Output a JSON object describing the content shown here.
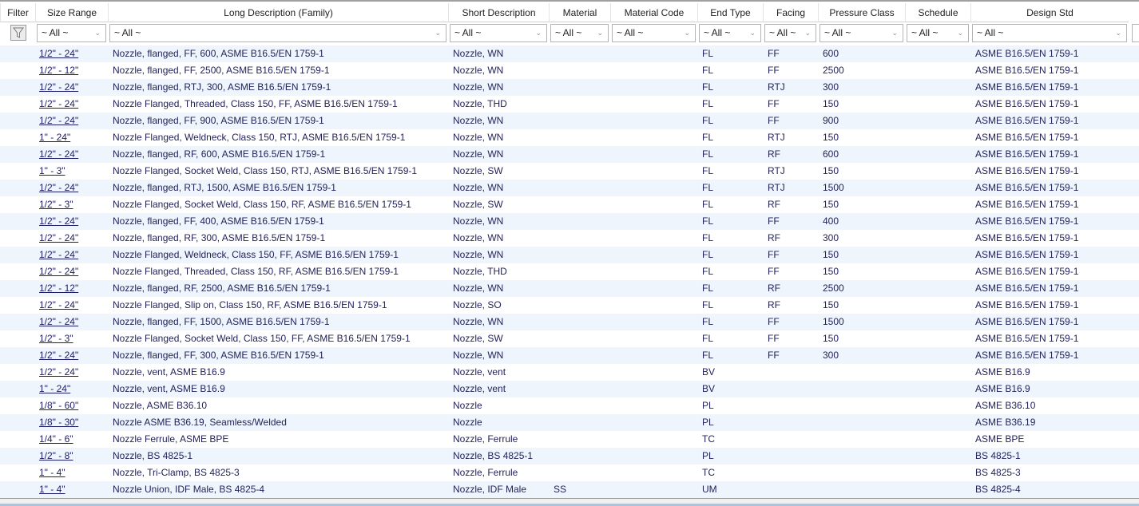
{
  "columns": [
    "Filter",
    "Size Range",
    "Long Description (Family)",
    "Short Description",
    "Material",
    "Material Code",
    "End Type",
    "Facing",
    "Pressure Class",
    "Schedule",
    "Design Std"
  ],
  "filter_value": "~ All ~",
  "icons": {
    "filter": "funnel-icon",
    "dropdown": "chevron-down-icon",
    "sort": "sort-down-icon"
  },
  "rows": [
    [
      "1/2\" - 24\"",
      "Nozzle, flanged, FF, 600, ASME B16.5/EN 1759-1",
      "Nozzle, WN",
      "",
      "",
      "FL",
      "FF",
      "600",
      "",
      "ASME B16.5/EN 1759-1"
    ],
    [
      "1/2\" - 12\"",
      "Nozzle, flanged, FF, 2500, ASME B16.5/EN 1759-1",
      "Nozzle, WN",
      "",
      "",
      "FL",
      "FF",
      "2500",
      "",
      "ASME B16.5/EN 1759-1"
    ],
    [
      "1/2\" - 24\"",
      "Nozzle, flanged, RTJ, 300, ASME B16.5/EN 1759-1",
      "Nozzle, WN",
      "",
      "",
      "FL",
      "RTJ",
      "300",
      "",
      "ASME B16.5/EN 1759-1"
    ],
    [
      "1/2\" - 24\"",
      "Nozzle Flanged, Threaded, Class 150, FF, ASME B16.5/EN 1759-1",
      "Nozzle, THD",
      "",
      "",
      "FL",
      "FF",
      "150",
      "",
      "ASME B16.5/EN 1759-1"
    ],
    [
      "1/2\" - 24\"",
      "Nozzle, flanged, FF, 900, ASME B16.5/EN 1759-1",
      "Nozzle, WN",
      "",
      "",
      "FL",
      "FF",
      "900",
      "",
      "ASME B16.5/EN 1759-1"
    ],
    [
      "1\" - 24\"",
      "Nozzle Flanged, Weldneck, Class 150, RTJ, ASME B16.5/EN 1759-1",
      "Nozzle, WN",
      "",
      "",
      "FL",
      "RTJ",
      "150",
      "",
      "ASME B16.5/EN 1759-1"
    ],
    [
      "1/2\" - 24\"",
      "Nozzle, flanged, RF, 600, ASME B16.5/EN 1759-1",
      "Nozzle, WN",
      "",
      "",
      "FL",
      "RF",
      "600",
      "",
      "ASME B16.5/EN 1759-1"
    ],
    [
      "1\" - 3\"",
      "Nozzle Flanged, Socket Weld, Class 150, RTJ, ASME B16.5/EN 1759-1",
      "Nozzle, SW",
      "",
      "",
      "FL",
      "RTJ",
      "150",
      "",
      "ASME B16.5/EN 1759-1"
    ],
    [
      "1/2\" - 24\"",
      "Nozzle, flanged, RTJ, 1500, ASME B16.5/EN 1759-1",
      "Nozzle, WN",
      "",
      "",
      "FL",
      "RTJ",
      "1500",
      "",
      "ASME B16.5/EN 1759-1"
    ],
    [
      "1/2\" - 3\"",
      "Nozzle Flanged, Socket Weld, Class 150, RF, ASME B16.5/EN 1759-1",
      "Nozzle, SW",
      "",
      "",
      "FL",
      "RF",
      "150",
      "",
      "ASME B16.5/EN 1759-1"
    ],
    [
      "1/2\" - 24\"",
      "Nozzle, flanged, FF, 400, ASME B16.5/EN 1759-1",
      "Nozzle, WN",
      "",
      "",
      "FL",
      "FF",
      "400",
      "",
      "ASME B16.5/EN 1759-1"
    ],
    [
      "1/2\" - 24\"",
      "Nozzle, flanged, RF, 300, ASME B16.5/EN 1759-1",
      "Nozzle, WN",
      "",
      "",
      "FL",
      "RF",
      "300",
      "",
      "ASME B16.5/EN 1759-1"
    ],
    [
      "1/2\" - 24\"",
      "Nozzle Flanged, Weldneck, Class 150, FF, ASME B16.5/EN 1759-1",
      "Nozzle, WN",
      "",
      "",
      "FL",
      "FF",
      "150",
      "",
      "ASME B16.5/EN 1759-1"
    ],
    [
      "1/2\" - 24\"",
      "Nozzle Flanged, Threaded, Class 150, RF, ASME B16.5/EN 1759-1",
      "Nozzle, THD",
      "",
      "",
      "FL",
      "FF",
      "150",
      "",
      "ASME B16.5/EN 1759-1"
    ],
    [
      "1/2\" - 12\"",
      "Nozzle, flanged, RF, 2500, ASME B16.5/EN 1759-1",
      "Nozzle, WN",
      "",
      "",
      "FL",
      "RF",
      "2500",
      "",
      "ASME B16.5/EN 1759-1"
    ],
    [
      "1/2\" - 24\"",
      "Nozzle Flanged, Slip on, Class 150, RF, ASME B16.5/EN 1759-1",
      "Nozzle, SO",
      "",
      "",
      "FL",
      "RF",
      "150",
      "",
      "ASME B16.5/EN 1759-1"
    ],
    [
      "1/2\" - 24\"",
      "Nozzle, flanged, FF, 1500, ASME B16.5/EN 1759-1",
      "Nozzle, WN",
      "",
      "",
      "FL",
      "FF",
      "1500",
      "",
      "ASME B16.5/EN 1759-1"
    ],
    [
      "1/2\" - 3\"",
      "Nozzle Flanged, Socket Weld, Class 150, FF, ASME B16.5/EN 1759-1",
      "Nozzle, SW",
      "",
      "",
      "FL",
      "FF",
      "150",
      "",
      "ASME B16.5/EN 1759-1"
    ],
    [
      "1/2\" - 24\"",
      "Nozzle, flanged, FF, 300, ASME B16.5/EN 1759-1",
      "Nozzle, WN",
      "",
      "",
      "FL",
      "FF",
      "300",
      "",
      "ASME B16.5/EN 1759-1"
    ],
    [
      "1/2\" - 24\"",
      "Nozzle, vent, ASME B16.9",
      "Nozzle, vent",
      "",
      "",
      "BV",
      "",
      "",
      "",
      "ASME B16.9"
    ],
    [
      "1\" - 24\"",
      "Nozzle, vent, ASME B16.9",
      "Nozzle, vent",
      "",
      "",
      "BV",
      "",
      "",
      "",
      "ASME B16.9"
    ],
    [
      "1/8\" - 60\"",
      "Nozzle, ASME B36.10",
      "Nozzle",
      "",
      "",
      "PL",
      "",
      "",
      "",
      "ASME B36.10"
    ],
    [
      "1/8\" - 30\"",
      "Nozzle ASME B36.19, Seamless/Welded",
      "Nozzle",
      "",
      "",
      "PL",
      "",
      "",
      "",
      "ASME B36.19"
    ],
    [
      "1/4\" - 6\"",
      "Nozzle Ferrule, ASME BPE",
      "Nozzle, Ferrule",
      "",
      "",
      "TC",
      "",
      "",
      "",
      "ASME BPE"
    ],
    [
      "1/2\" - 8\"",
      "Nozzle, BS 4825-1",
      "Nozzle, BS 4825-1",
      "",
      "",
      "PL",
      "",
      "",
      "",
      "BS 4825-1"
    ],
    [
      "1\" - 4\"",
      "Nozzle, Tri-Clamp, BS 4825-3",
      "Nozzle, Ferrule",
      "",
      "",
      "TC",
      "",
      "",
      "",
      "BS 4825-3"
    ],
    [
      "1\" - 4\"",
      "Nozzle Union, IDF Male, BS 4825-4",
      "Nozzle, IDF Male",
      "SS",
      "",
      "UM",
      "",
      "",
      "",
      "BS 4825-4"
    ]
  ]
}
